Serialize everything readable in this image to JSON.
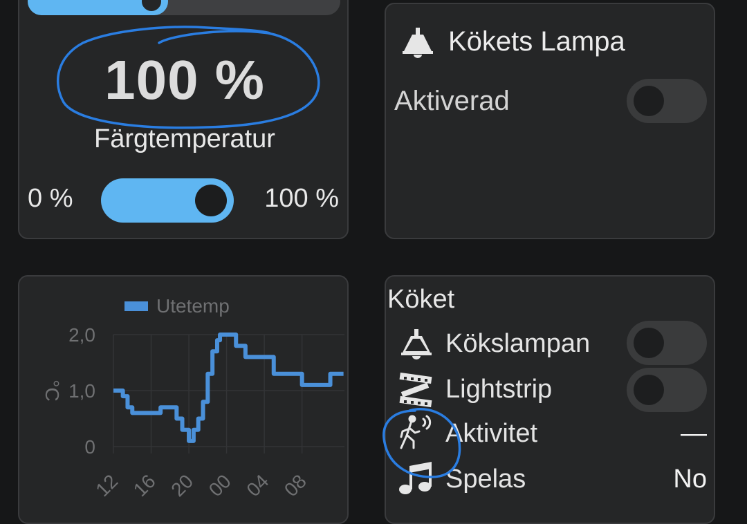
{
  "light_card": {
    "brightness_level": 0.45,
    "brightness_value": "100 %",
    "color_temp_label": "Färgtemperatur",
    "color_temp_min": "0 %",
    "color_temp_max": "100 %",
    "color_temp_level": 1.0
  },
  "lamp_card": {
    "icon": "ceiling-lamp-icon",
    "title": "Kökets Lampa",
    "activated_label": "Aktiverad",
    "activated_state": false
  },
  "koket_card": {
    "title": "Köket",
    "rows": [
      {
        "icon": "ceiling-lamp-icon",
        "label": "Kökslampan",
        "type": "toggle",
        "state": false
      },
      {
        "icon": "light-strip-icon",
        "label": "Lightstrip",
        "type": "toggle",
        "state": false
      },
      {
        "icon": "motion-sensor-icon",
        "label": "Aktivitet",
        "type": "value",
        "value": "—"
      },
      {
        "icon": "music-note-icon",
        "label": "Spelas",
        "type": "value",
        "value": "No"
      }
    ]
  },
  "colors": {
    "accent": "#5fb6f2",
    "card_bg": "#252627",
    "page_bg": "#161718",
    "annotation": "#2a7de1"
  },
  "chart_data": {
    "type": "line",
    "legend": "Utetemp",
    "ylabel": "°C",
    "ylim": [
      0,
      2.0
    ],
    "yticks": [
      "0",
      "1,0",
      "2,0"
    ],
    "xticks": [
      "12",
      "16",
      "20",
      "00",
      "04",
      "08"
    ],
    "step": true,
    "x": [
      12,
      13,
      13.5,
      14,
      15,
      16,
      17,
      18,
      18.7,
      19.3,
      20,
      20.5,
      21,
      21.5,
      22,
      22.5,
      23,
      23.3,
      24,
      25,
      26,
      27,
      28,
      29,
      30,
      31,
      32,
      33,
      34,
      35,
      36
    ],
    "y": [
      1.0,
      0.9,
      0.7,
      0.6,
      0.6,
      0.6,
      0.7,
      0.7,
      0.5,
      0.3,
      0.1,
      0.3,
      0.5,
      0.8,
      1.3,
      1.7,
      1.9,
      2.0,
      2.0,
      1.8,
      1.6,
      1.6,
      1.6,
      1.3,
      1.3,
      1.3,
      1.1,
      1.1,
      1.1,
      1.3,
      1.3
    ]
  }
}
